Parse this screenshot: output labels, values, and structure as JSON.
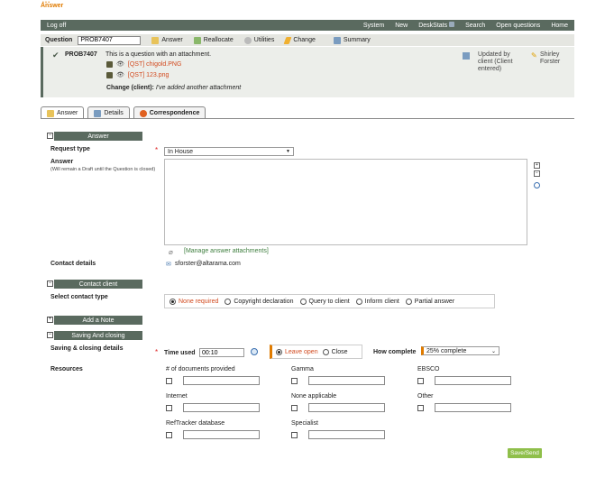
{
  "brand": {
    "name": "Answer"
  },
  "topbar": {
    "logoff": "Log off",
    "menu": [
      "System",
      "New",
      "DeskStats",
      "Search",
      "Open questions",
      "Home"
    ]
  },
  "question_bar": {
    "label": "Question",
    "ref_value": "PROB7407",
    "buttons": [
      "Answer",
      "Reallocate",
      "Utilities",
      "Change",
      "Summary"
    ]
  },
  "question_info": {
    "ref": "PROB7407",
    "description": "This is a question with an attachment.",
    "attachments": [
      "[QST] chigold.PNG",
      "[QST] 123.png"
    ],
    "change_label": "Change (client):",
    "change_text": "I've added another attachment",
    "updated_by": "Updated by client (Client entered)",
    "user": "Shirley Forster"
  },
  "tabs": [
    {
      "label": "Answer",
      "active": true
    },
    {
      "label": "Details",
      "active": false
    },
    {
      "label": "Correspondence",
      "active": false
    }
  ],
  "answer_section": {
    "title": "Answer",
    "request_type_label": "Request type",
    "request_type_value": "In House",
    "answer_label": "Answer",
    "answer_sublabel": "(Will remain a Draft until the Question is closed)",
    "manage_attachments": "[Manage answer attachments]",
    "contact_details_label": "Contact details",
    "contact_email": "sforster@altarama.com"
  },
  "contact_client_section": {
    "title": "Contact client",
    "select_label": "Select contact type",
    "options": [
      "None required",
      "Copyright declaration",
      "Query to client",
      "Inform client",
      "Partial answer"
    ],
    "selected": "None required"
  },
  "add_note_section": {
    "title": "Add a Note"
  },
  "saving_section": {
    "title": "Saving And closing",
    "details_label": "Saving & closing details",
    "time_used_label": "Time used",
    "time_used_value": "00:10",
    "leave_open": "Leave open",
    "close": "Close",
    "how_complete_label": "How complete",
    "how_complete_value": "25% complete",
    "resources_label": "Resources",
    "resources": [
      "# of documents provided",
      "Gamma",
      "EBSCO",
      "Internet",
      "None applicable",
      "Other",
      "RefTracker database",
      "Specialist"
    ]
  },
  "save_button": "Save/Send",
  "colors": {
    "header": "#5a6a5f",
    "accent_orange": "#e07b00",
    "link_red": "#d24a1f",
    "save_green": "#8fbf4a"
  }
}
